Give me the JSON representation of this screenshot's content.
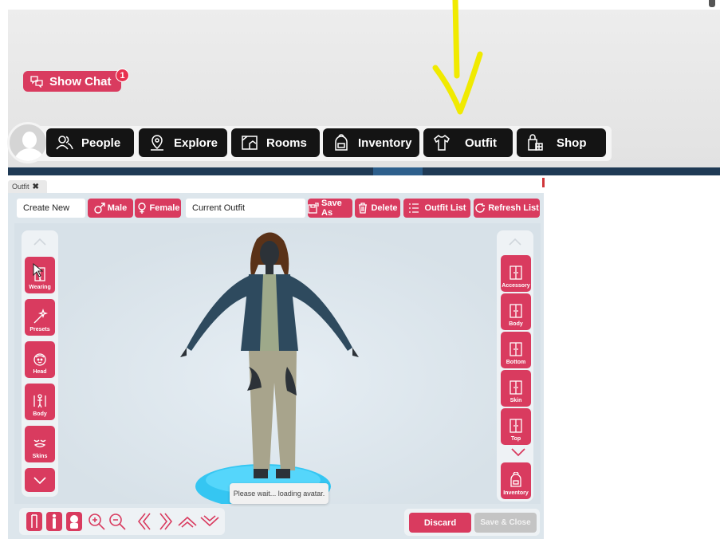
{
  "game": {
    "show_chat_label": "Show Chat",
    "chat_badge_count": "1"
  },
  "navbar": {
    "items": [
      {
        "label": "People",
        "icon": "people-icon"
      },
      {
        "label": "Explore",
        "icon": "location-pin-icon"
      },
      {
        "label": "Rooms",
        "icon": "rooms-icon"
      },
      {
        "label": "Inventory",
        "icon": "backpack-icon"
      },
      {
        "label": "Outfit",
        "icon": "shirt-icon"
      },
      {
        "label": "Shop",
        "icon": "shopping-bag-icon"
      }
    ]
  },
  "outfit_window": {
    "tab_title": "Outfit",
    "create_new_label": "Create New",
    "male_label": "Male",
    "female_label": "Female",
    "current_outfit_label": "Current Outfit",
    "save_as_label": "Save As",
    "delete_label": "Delete",
    "outfit_list_label": "Outfit List",
    "refresh_list_label": "Refresh List",
    "left_categories": [
      "Wearing",
      "Presets",
      "Head",
      "Body",
      "Skins"
    ],
    "right_categories": [
      "Accessory",
      "Body",
      "Bottom",
      "Skin",
      "Top",
      "Inventory"
    ],
    "loading_text": "Please wait... loading avatar.",
    "discard_label": "Discard",
    "save_close_label": "Save & Close"
  },
  "colors": {
    "accent": "#d93b5f",
    "nav_button": "#141414",
    "annotation_arrow": "#f0ea00"
  }
}
